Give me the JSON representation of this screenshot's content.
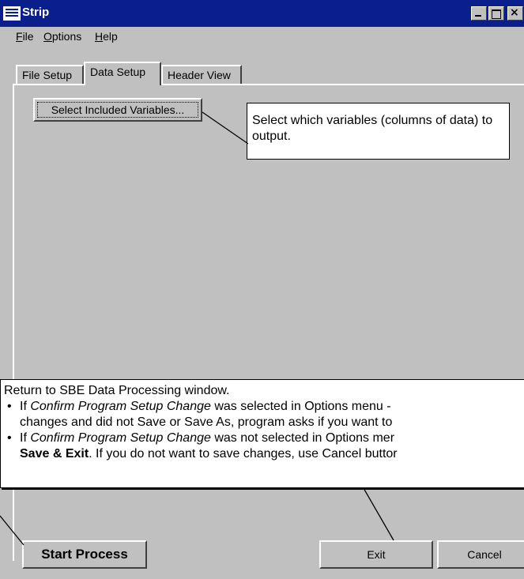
{
  "window": {
    "title": "Strip",
    "menu": [
      "File",
      "Options",
      "Help"
    ],
    "tabs": [
      "File Setup",
      "Data Setup",
      "Header View"
    ],
    "active_tab": "Data Setup"
  },
  "data_setup": {
    "select_variables_label": "Select Included Variables..."
  },
  "callouts": {
    "select_variables": "Select which variables (columns of data) to output.",
    "return_intro": "Return to SBE Data Processing window.",
    "bullet1": {
      "prefix": "If ",
      "emph": "Confirm Program Setup Change",
      "line1_rest": " was selected in Options menu -",
      "line2": "changes and did not Save or Save As, program asks if you want to"
    },
    "bullet2": {
      "prefix": "If ",
      "emph": "Confirm Program Setup Change",
      "line1_rest": " was not selected in Options mer",
      "line2_bold": "Save & Exit",
      "line2_rest": ". If you do not want to save changes, use Cancel buttor"
    }
  },
  "buttons": {
    "start_process": "Start Process",
    "exit": "Exit",
    "cancel": "Cancel"
  },
  "colors": {
    "titlebar": "#0b1f8c",
    "face": "#c0c0c0"
  }
}
